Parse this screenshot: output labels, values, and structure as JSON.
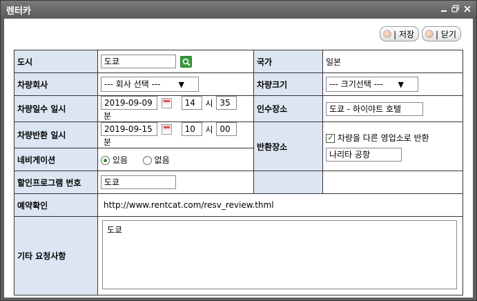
{
  "window": {
    "title": "렌터카"
  },
  "toolbar": {
    "save_label": "| 저장",
    "close_label": "| 닫기"
  },
  "labels": {
    "city": "도시",
    "country": "국가",
    "company": "차량회사",
    "car_size": "차량크기",
    "rental_date": "차량일수 일시",
    "pickup_place": "인수장소",
    "return_date": "차량반환 일시",
    "return_place": "반환장소",
    "navigation": "네비게이션",
    "discount_program": "할인프로그램 번호",
    "reservation_check": "예약확인",
    "other_requests": "기타 요청사항"
  },
  "form": {
    "city": "도쿄",
    "country": "일본",
    "company_select": "--- 회사 선택 ---",
    "size_select": "--- 크기선택 ---",
    "rental": {
      "date": "2019-09-09",
      "hour": "14",
      "hour_unit": "시",
      "minute": "35",
      "minute_unit": "분"
    },
    "return": {
      "date": "2019-09-15",
      "hour": "10",
      "hour_unit": "시",
      "minute": "00",
      "minute_unit": "분"
    },
    "pickup_place": "도쿄 - 하이야트 호텔",
    "return_other_branch_label": "차량을 다른 영업소로 반환",
    "return_place": "나리타 공항",
    "navigation": {
      "yes": "있음",
      "no": "없음",
      "selected": "있음"
    },
    "discount_program": "도쿄",
    "reservation_url": "http://www.rentcat.com/resv_review.thml",
    "other_requests": "도쿄"
  },
  "icons": {
    "search": "search-icon",
    "calendar": "calendar-icon",
    "minimize": "minimize-icon",
    "restore": "restore-icon",
    "close": "close-icon"
  }
}
